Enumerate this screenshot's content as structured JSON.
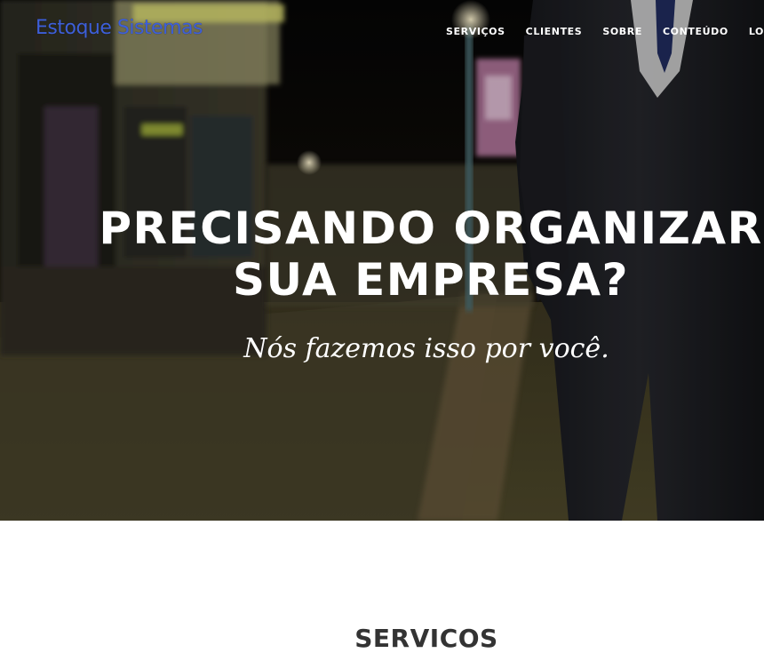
{
  "brand": {
    "name": "Estoque Sistemas"
  },
  "nav": {
    "items": [
      {
        "label": "SERVIÇOS"
      },
      {
        "label": "CLIENTES"
      },
      {
        "label": "SOBRE"
      },
      {
        "label": "CONTEÚDO"
      },
      {
        "label": "LOCALIZAÇÃO"
      }
    ]
  },
  "hero": {
    "heading_line1": "PRECISANDO ORGANIZAR",
    "heading_line2": "SUA EMPRESA?",
    "subheading": "Nós fazemos isso por você."
  },
  "services": {
    "title": "SERVICOS"
  },
  "colors": {
    "brand": "#3d5fd9",
    "heading": "#333333"
  }
}
